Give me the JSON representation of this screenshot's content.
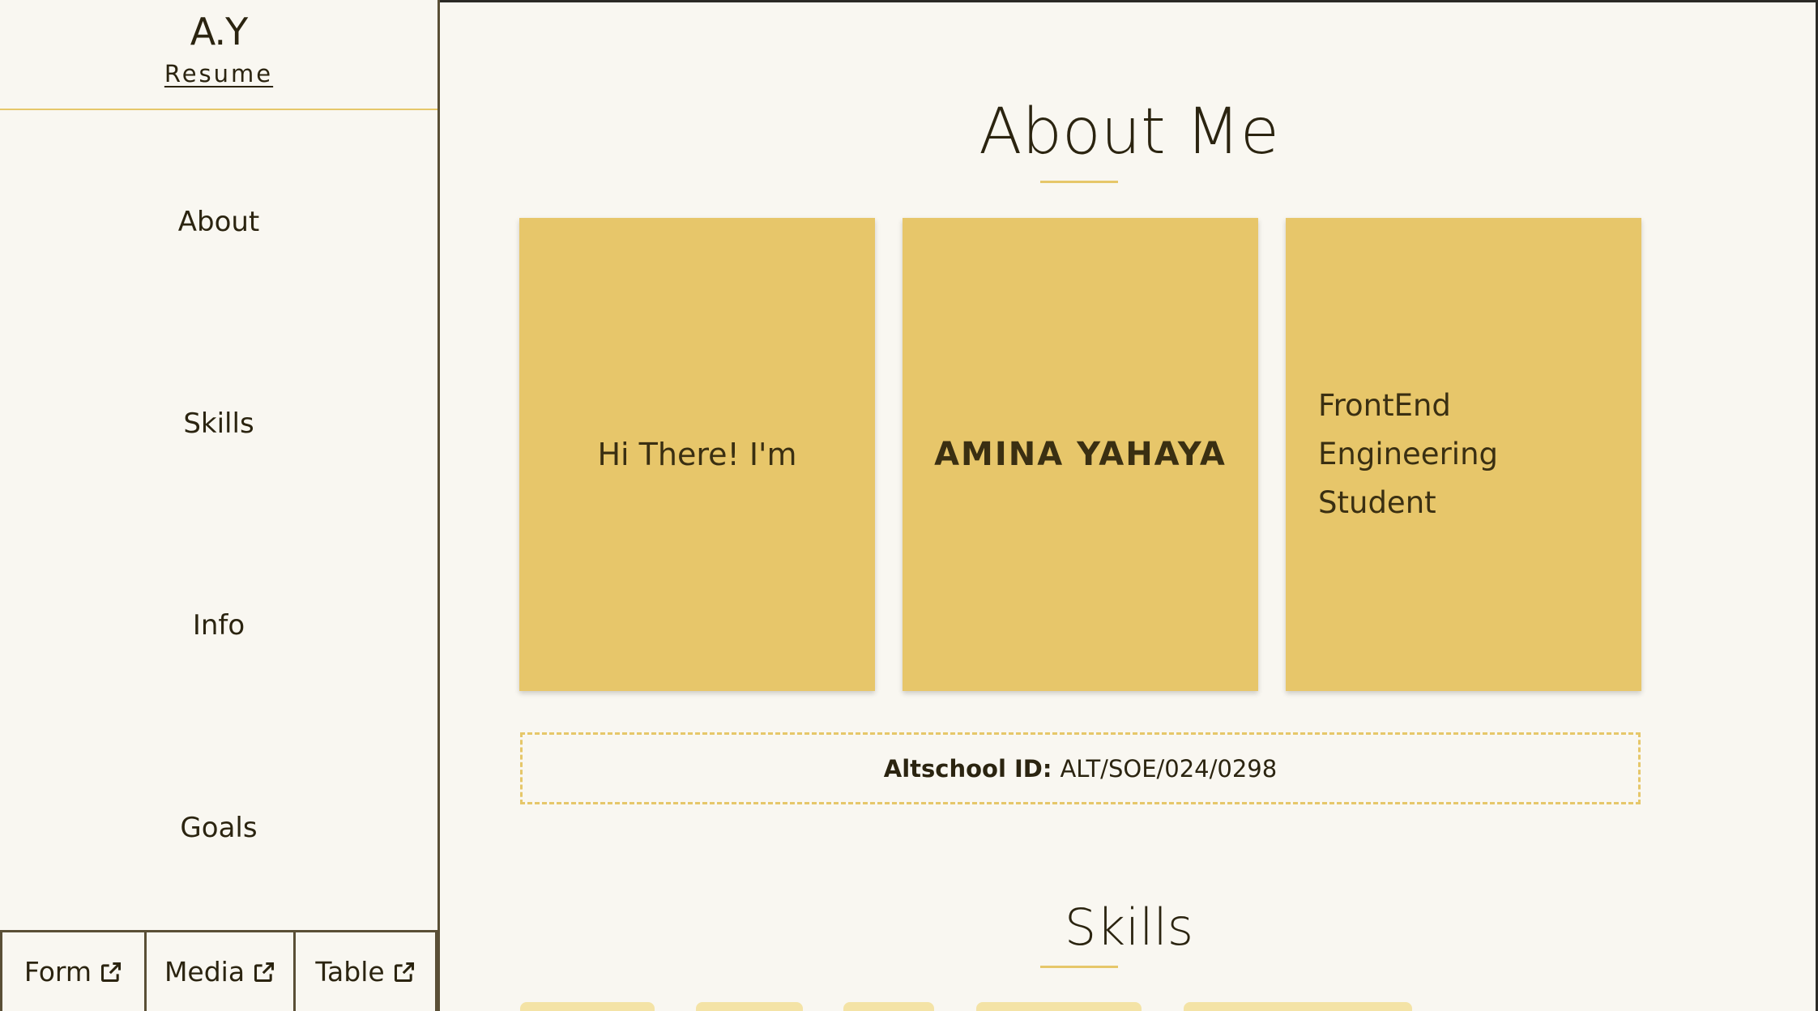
{
  "sidebar": {
    "brand": "A.Y",
    "resume_link": "Resume",
    "nav": [
      "About",
      "Skills",
      "Info",
      "Goals"
    ],
    "external_links": [
      {
        "label": "Form",
        "icon": "external-link-icon"
      },
      {
        "label": "Media",
        "icon": "external-link-icon"
      },
      {
        "label": "Table",
        "icon": "external-link-icon"
      }
    ]
  },
  "about": {
    "title": "About Me",
    "cards": [
      "Hi There! I'm",
      "AMINA YAHAYA",
      "FrontEnd Engineering Student"
    ],
    "id_label": "Altschool ID:",
    "id_value": "ALT/SOE/024/0298"
  },
  "skills": {
    "title": "Skills"
  },
  "colors": {
    "accent": "#e7c66a",
    "background": "#f9f7f1",
    "text": "#2b2410",
    "border": "#5a4f36"
  }
}
